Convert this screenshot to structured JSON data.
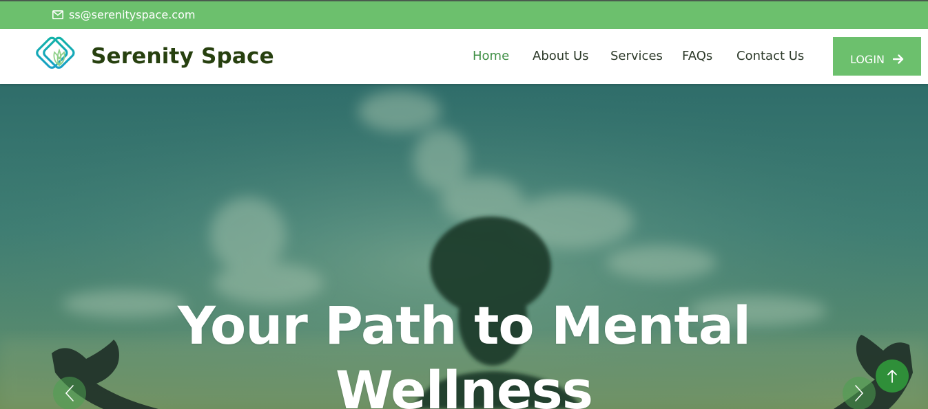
{
  "topbar": {
    "email": "ss@serenityspace.com",
    "icon": "mail-icon"
  },
  "brand": {
    "name": "Serenity Space",
    "logo_icon": "lotus-logo-icon",
    "color": "#27400f"
  },
  "nav": {
    "items": [
      {
        "label": "Home",
        "active": true
      },
      {
        "label": "About Us",
        "active": false
      },
      {
        "label": "Services",
        "active": false
      },
      {
        "label": "FAQs",
        "active": false
      },
      {
        "label": "Contact Us",
        "active": false
      }
    ],
    "login_label": "LOGIN",
    "login_icon": "arrow-right-icon"
  },
  "hero": {
    "title_line1": "Your Path to Mental",
    "title_line2": "Wellness",
    "prev_icon": "chevron-left-icon",
    "next_icon": "chevron-right-icon",
    "scroll_top_icon": "arrow-up-icon"
  },
  "colors": {
    "accent": "#6cc06d",
    "active_nav": "#3f8f45",
    "scroll_top": "#2f8f39",
    "text_dark": "#2d3a2a"
  }
}
